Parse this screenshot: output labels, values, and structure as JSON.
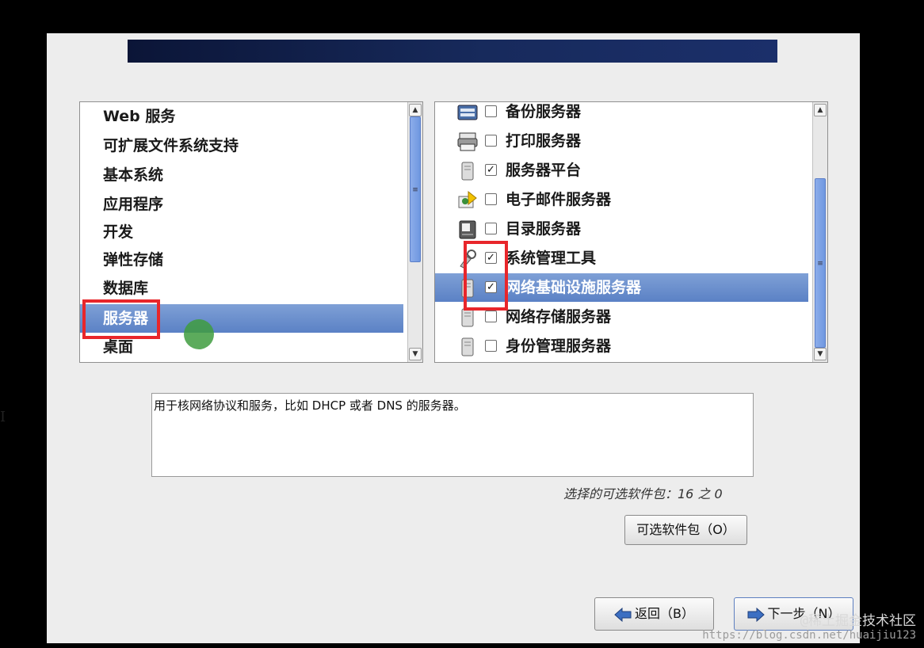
{
  "categories": {
    "items": [
      {
        "label": "Web 服务"
      },
      {
        "label": "可扩展文件系统支持"
      },
      {
        "label": "基本系统"
      },
      {
        "label": "应用程序"
      },
      {
        "label": "开发"
      },
      {
        "label": "弹性存储"
      },
      {
        "label": "数据库"
      },
      {
        "label": "服务器",
        "selected": true
      },
      {
        "label": "桌面"
      }
    ]
  },
  "packages": {
    "items": [
      {
        "label": "备份服务器",
        "checked": false,
        "icon": "backup-server-icon"
      },
      {
        "label": "打印服务器",
        "checked": false,
        "icon": "printer-icon"
      },
      {
        "label": "服务器平台",
        "checked": true,
        "icon": "server-icon"
      },
      {
        "label": "电子邮件服务器",
        "checked": false,
        "icon": "mail-server-icon"
      },
      {
        "label": "目录服务器",
        "checked": false,
        "icon": "directory-server-icon"
      },
      {
        "label": "系统管理工具",
        "checked": true,
        "icon": "admin-tools-icon"
      },
      {
        "label": "网络基础设施服务器",
        "checked": true,
        "icon": "server-icon",
        "selected": true
      },
      {
        "label": "网络存储服务器",
        "checked": false,
        "icon": "server-icon"
      },
      {
        "label": "身份管理服务器",
        "checked": false,
        "icon": "server-icon"
      }
    ]
  },
  "description": "用于核网络协议和服务，比如 DHCP 或者 DNS 的服务器。",
  "optional_count": "选择的可选软件包：16 之 0",
  "buttons": {
    "optional": "可选软件包（O）",
    "back": "返回（B）",
    "next": "下一步（N）"
  },
  "scrollbar_grip": "≡",
  "watermark": {
    "line1": "@稀土掘金技术社区",
    "line2": "https://blog.csdn.net/huaijiu123"
  },
  "colors": {
    "selection": "#6b8fce",
    "highlight_box": "#e8262b",
    "banner": "#14224e"
  }
}
